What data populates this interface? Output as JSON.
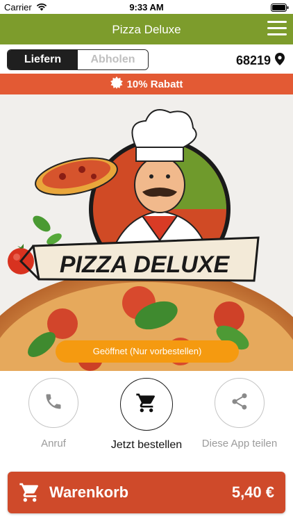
{
  "status_bar": {
    "carrier": "Carrier",
    "time": "9:33 AM"
  },
  "app_bar": {
    "title": "Pizza Deluxe",
    "menu_icon": "hamburger-menu-icon",
    "color": "#7d9c2c"
  },
  "order_mode": {
    "options": [
      "Liefern",
      "Abholen"
    ],
    "selected": "Liefern",
    "postal_code": "68219",
    "location_icon": "map-pin-icon"
  },
  "discount": {
    "icon": "badge-burst-icon",
    "text": "10% Rabatt",
    "color": "#e35a34"
  },
  "hero": {
    "logo_text": "PIZZA DELUXE",
    "open_status": "Geöffnet (Nur vorbestellen)",
    "status_color": "#f59a10"
  },
  "actions": [
    {
      "label": "Anruf",
      "icon": "phone-icon"
    },
    {
      "label": "Jetzt bestellen",
      "icon": "cart-icon"
    },
    {
      "label": "Diese App teilen",
      "icon": "share-icon"
    }
  ],
  "cart": {
    "label": "Warenkorb",
    "total": "5,40 €",
    "icon": "cart-icon",
    "color": "#cf4a2a"
  }
}
